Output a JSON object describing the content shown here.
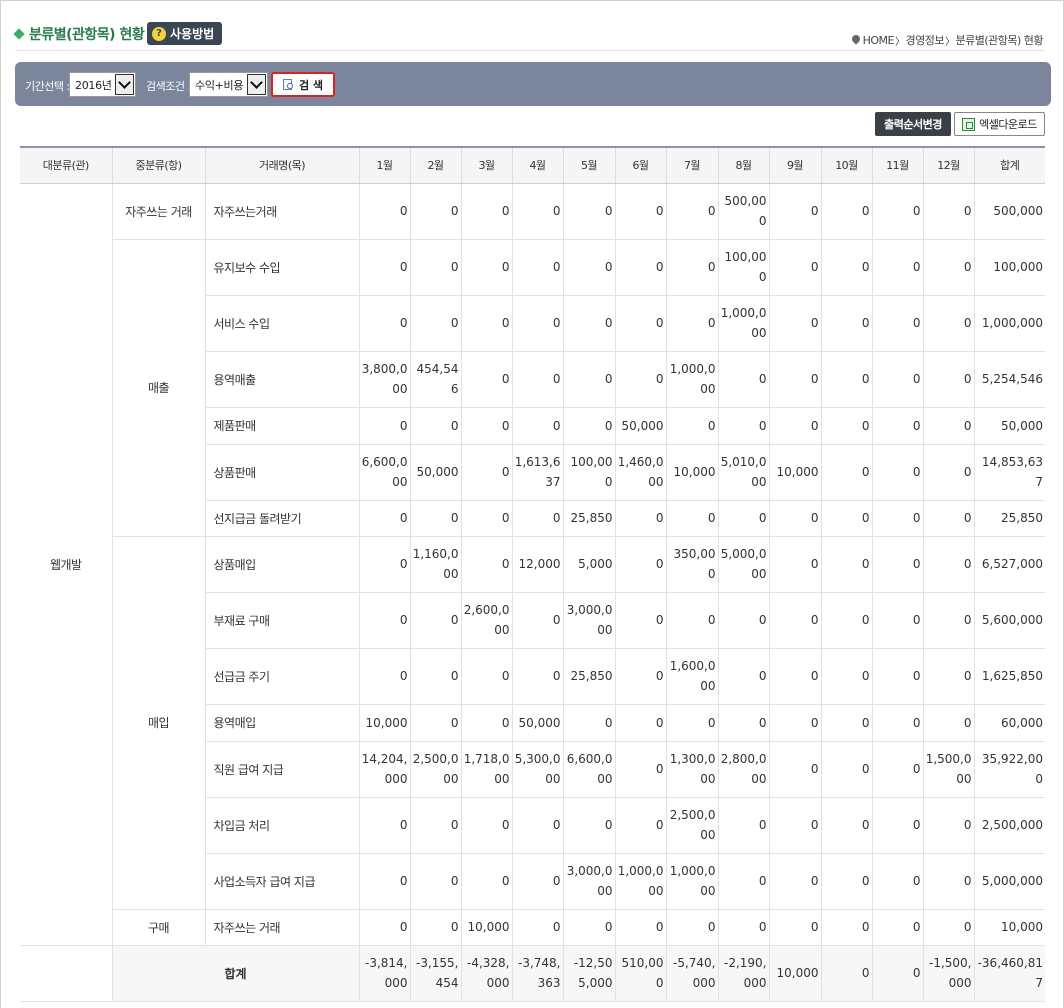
{
  "header": {
    "title": "분류별(관항목) 현황",
    "help_label": "사용방법",
    "help_icon": "?",
    "breadcrumb": [
      "HOME",
      "경영정보",
      "분류별(관항목) 현황"
    ]
  },
  "search": {
    "period_label": "기간선택 :",
    "period_value": "2016년",
    "condition_label": "검색조건 :",
    "condition_value": "수익+비용",
    "search_button": "검 색"
  },
  "actions": {
    "order_button": "출력순서변경",
    "excel_button": "엑셀다운로드"
  },
  "table": {
    "headers": [
      "대분류(관)",
      "중분류(항)",
      "거래명(목)",
      "1월",
      "2월",
      "3월",
      "4월",
      "5월",
      "6월",
      "7월",
      "8월",
      "9월",
      "10월",
      "11월",
      "12월",
      "합계"
    ],
    "big_category": "웹개발",
    "groups": [
      {
        "name": "자주쓰는 거래",
        "rows": [
          {
            "item": "자주쓰는거래",
            "values": [
              "0",
              "0",
              "0",
              "0",
              "0",
              "0",
              "0",
              "500,000",
              "0",
              "0",
              "0",
              "0",
              "500,000"
            ]
          }
        ]
      },
      {
        "name": "매출",
        "rows": [
          {
            "item": "유지보수 수입",
            "values": [
              "0",
              "0",
              "0",
              "0",
              "0",
              "0",
              "0",
              "100,000",
              "0",
              "0",
              "0",
              "0",
              "100,000"
            ]
          },
          {
            "item": "서비스 수입",
            "values": [
              "0",
              "0",
              "0",
              "0",
              "0",
              "0",
              "0",
              "1,000,000",
              "0",
              "0",
              "0",
              "0",
              "1,000,000"
            ]
          },
          {
            "item": "용역매출",
            "values": [
              "3,800,000",
              "454,546",
              "0",
              "0",
              "0",
              "0",
              "1,000,000",
              "0",
              "0",
              "0",
              "0",
              "0",
              "5,254,546"
            ]
          },
          {
            "item": "제품판매",
            "values": [
              "0",
              "0",
              "0",
              "0",
              "0",
              "50,000",
              "0",
              "0",
              "0",
              "0",
              "0",
              "0",
              "50,000"
            ]
          },
          {
            "item": "상품판매",
            "values": [
              "6,600,000",
              "50,000",
              "0",
              "1,613,637",
              "100,000",
              "1,460,000",
              "10,000",
              "5,010,000",
              "10,000",
              "0",
              "0",
              "0",
              "14,853,637"
            ]
          },
          {
            "item": "선지급금 돌려받기",
            "values": [
              "0",
              "0",
              "0",
              "0",
              "25,850",
              "0",
              "0",
              "0",
              "0",
              "0",
              "0",
              "0",
              "25,850"
            ]
          }
        ]
      },
      {
        "name": "매입",
        "rows": [
          {
            "item": "상품매입",
            "values": [
              "0",
              "1,160,000",
              "0",
              "12,000",
              "5,000",
              "0",
              "350,000",
              "5,000,000",
              "0",
              "0",
              "0",
              "0",
              "6,527,000"
            ]
          },
          {
            "item": "부재료 구매",
            "values": [
              "0",
              "0",
              "2,600,000",
              "0",
              "3,000,000",
              "0",
              "0",
              "0",
              "0",
              "0",
              "0",
              "0",
              "5,600,000"
            ]
          },
          {
            "item": "선급금 주기",
            "values": [
              "0",
              "0",
              "0",
              "0",
              "25,850",
              "0",
              "1,600,000",
              "0",
              "0",
              "0",
              "0",
              "0",
              "1,625,850"
            ]
          },
          {
            "item": "용역매입",
            "values": [
              "10,000",
              "0",
              "0",
              "50,000",
              "0",
              "0",
              "0",
              "0",
              "0",
              "0",
              "0",
              "0",
              "60,000"
            ]
          },
          {
            "item": "직원 급여 지급",
            "values": [
              "14,204,000",
              "2,500,000",
              "1,718,000",
              "5,300,000",
              "6,600,000",
              "0",
              "1,300,000",
              "2,800,000",
              "0",
              "0",
              "0",
              "1,500,000",
              "35,922,000"
            ]
          },
          {
            "item": "차입금 처리",
            "values": [
              "0",
              "0",
              "0",
              "0",
              "0",
              "0",
              "2,500,000",
              "0",
              "0",
              "0",
              "0",
              "0",
              "2,500,000"
            ]
          },
          {
            "item": "사업소득자 급여 지급",
            "values": [
              "0",
              "0",
              "0",
              "0",
              "3,000,000",
              "1,000,000",
              "1,000,000",
              "0",
              "0",
              "0",
              "0",
              "0",
              "5,000,000"
            ]
          }
        ]
      },
      {
        "name": "구매",
        "rows": [
          {
            "item": "자주쓰는 거래",
            "values": [
              "0",
              "0",
              "10,000",
              "0",
              "0",
              "0",
              "0",
              "0",
              "0",
              "0",
              "0",
              "0",
              "10,000"
            ]
          }
        ]
      }
    ],
    "total_label": "합계",
    "totals": [
      "-3,814,000",
      "-3,155,454",
      "-4,328,000",
      "-3,748,363",
      "-12,505,000",
      "510,000",
      "-5,740,000",
      "-2,190,000",
      "10,000",
      "0",
      "0",
      "-1,500,000",
      "-36,460,817"
    ]
  }
}
